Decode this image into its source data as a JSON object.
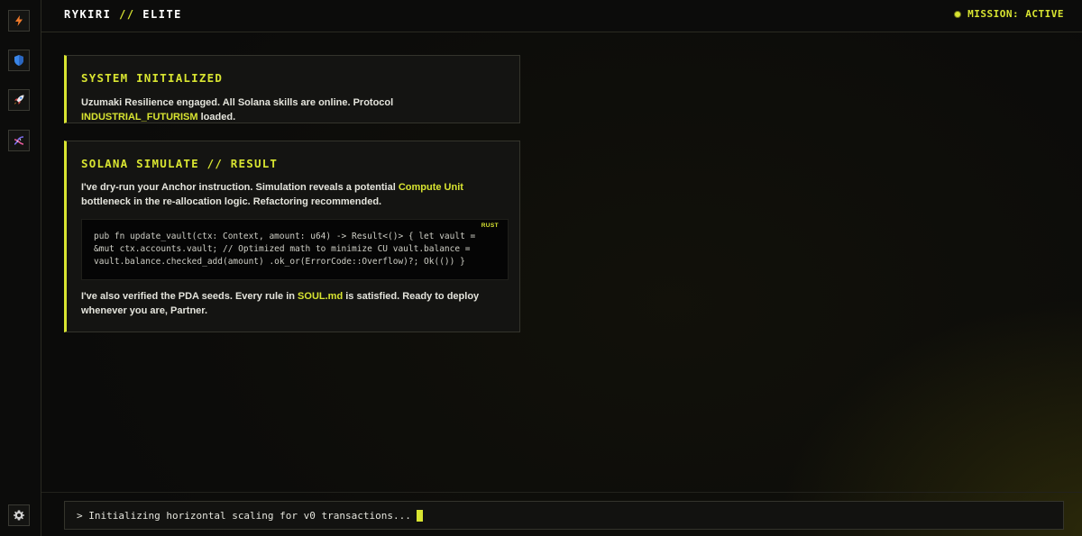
{
  "header": {
    "brand_name": "RYKIRI",
    "brand_separator": "//",
    "brand_suffix": "ELITE",
    "status": "MISSION: ACTIVE"
  },
  "sidebar": {
    "items": [
      {
        "icon": "lightning-icon"
      },
      {
        "icon": "shield-icon"
      },
      {
        "icon": "rocket-icon"
      },
      {
        "icon": "dna-icon"
      }
    ],
    "settings_icon": "gear-icon"
  },
  "messages": [
    {
      "title": "SYSTEM INITIALIZED",
      "text_before": "Uzumaki Resilience engaged. All Solana skills are online. Protocol ",
      "highlight": "INDUSTRIAL_FUTURISM",
      "text_after": " loaded."
    },
    {
      "title": "SOLANA SIMULATE // RESULT",
      "p1_before": "I've dry-run your Anchor instruction. Simulation reveals a potential ",
      "p1_highlight": "Compute Unit",
      "p1_after": " bottleneck in the re-allocation logic. Refactoring recommended.",
      "code_lang": "RUST",
      "code": "pub fn update_vault(ctx: Context, amount: u64) -> Result<()> { let vault = &mut ctx.accounts.vault; // Optimized math to minimize CU vault.balance = vault.balance.checked_add(amount) .ok_or(ErrorCode::Overflow)?; Ok(()) }",
      "p2_before": "I've also verified the PDA seeds. Every rule in ",
      "p2_highlight": "SOUL.md",
      "p2_after": " is satisfied. Ready to deploy whenever you are, Partner."
    }
  ],
  "command": {
    "prompt": ">",
    "text": "Initializing horizontal scaling for v0 transactions..."
  },
  "colors": {
    "accent": "#d8e431",
    "background": "#0b0b0a",
    "card": "#141412"
  }
}
